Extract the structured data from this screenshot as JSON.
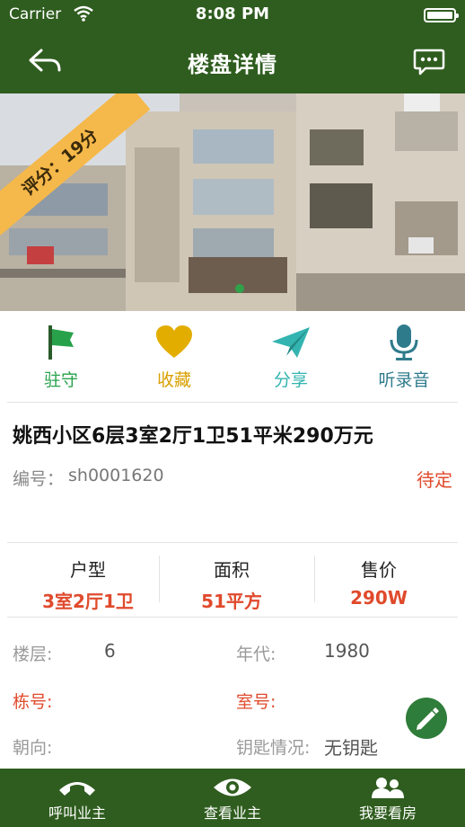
{
  "status_bar": {
    "carrier": "Carrier",
    "time": "8:08 PM"
  },
  "nav": {
    "title": "楼盘详情"
  },
  "hero": {
    "rating_badge": "评分：19分"
  },
  "actions": [
    {
      "label": "驻守",
      "icon": "flag-icon",
      "color": "#27a24a"
    },
    {
      "label": "收藏",
      "icon": "heart-icon",
      "color": "#d9a000"
    },
    {
      "label": "分享",
      "icon": "paper-plane-icon",
      "color": "#33b4b0"
    },
    {
      "label": "听录音",
      "icon": "microphone-icon",
      "color": "#2e7b8c"
    }
  ],
  "listing": {
    "title": "姚西小区6层3室2厅1卫51平米290万元",
    "code_label": "编号：",
    "code_value": "sh0001620",
    "status": "待定"
  },
  "stats": [
    {
      "label": "户型",
      "value": "3室2厅1卫"
    },
    {
      "label": "面积",
      "value": "51平方"
    },
    {
      "label": "售价",
      "value": "290W"
    }
  ],
  "details": {
    "floor_label": "楼层:",
    "floor_value": "6",
    "year_label": "年代:",
    "year_value": "1980",
    "building_label": "栋号:",
    "room_label": "室号:",
    "orientation_label": "朝向:",
    "key_label": "钥匙情况:",
    "key_value": "无钥匙"
  },
  "tabbar": [
    {
      "label": "呼叫业主",
      "icon": "phone-icon"
    },
    {
      "label": "查看业主",
      "icon": "eye-icon"
    },
    {
      "label": "我要看房",
      "icon": "people-icon"
    }
  ],
  "colors": {
    "primary": "#2f5d1f",
    "accent_red": "#e04a2c",
    "ribbon": "#f5b84a"
  }
}
